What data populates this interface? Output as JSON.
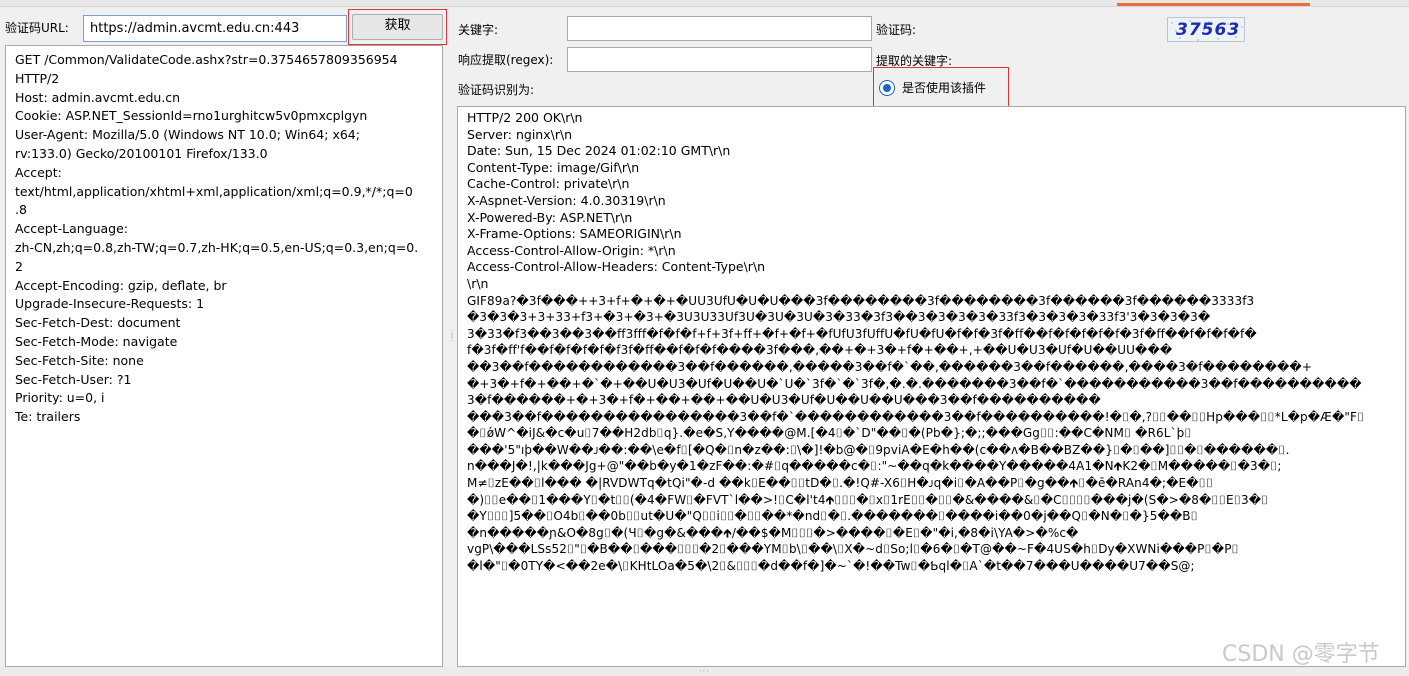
{
  "left": {
    "url_label": "验证码URL:",
    "url_value": "https://admin.avcmt.edu.cn:443",
    "fetch_button": "获取",
    "request_lines": [
      "GET /Common/ValidateCode.ashx?str=0.3754657809356954",
      "HTTP/2",
      "Host: admin.avcmt.edu.cn",
      "Cookie: ASP.NET_SessionId=rno1urghitcw5v0pmxcplgyn",
      "User-Agent: Mozilla/5.0 (Windows NT 10.0; Win64; x64;",
      "rv:133.0) Gecko/20100101 Firefox/133.0",
      "Accept:",
      "text/html,application/xhtml+xml,application/xml;q=0.9,*/*;q=0",
      ".8",
      "Accept-Language:",
      "zh-CN,zh;q=0.8,zh-TW;q=0.7,zh-HK;q=0.5,en-US;q=0.3,en;q=0.",
      "2",
      "Accept-Encoding: gzip, deflate, br",
      "Upgrade-Insecure-Requests: 1",
      "Sec-Fetch-Dest: document",
      "Sec-Fetch-Mode: navigate",
      "Sec-Fetch-Site: none",
      "Sec-Fetch-User: ?1",
      "Priority: u=0, i",
      "Te: trailers"
    ]
  },
  "right": {
    "keyword_label": "关键字:",
    "keyword_value": "",
    "regex_label": "响应提取(regex):",
    "regex_value": "",
    "recognized_label": "验证码识别为:",
    "captcha_label": "验证码:",
    "captcha_text": "37563",
    "extracted_label": "提取的关键字:",
    "plugin_radio_label": "是否使用该插件",
    "plugin_radio_checked": true,
    "response_lines": [
      "HTTP/2 200 OK\\r\\n",
      "Server: nginx\\r\\n",
      "Date: Sun, 15 Dec 2024 01:02:10 GMT\\r\\n",
      "Content-Type: image/Gif\\r\\n",
      "Cache-Control: private\\r\\n",
      "X-Aspnet-Version: 4.0.30319\\r\\n",
      "X-Powered-By: ASP.NET\\r\\n",
      "X-Frame-Options: SAMEORIGIN\\r\\n",
      "Access-Control-Allow-Origin: *\\r\\n",
      "Access-Control-Allow-Headers: Content-Type\\r\\n",
      "\\r\\n"
    ],
    "binary_lines": [
      "GIF89a?�3f���++3+f+�+�+�UU3UfU�U�U���3f��������3f��������3f������3f������3333f3",
      "�3�3�3+3+33+f3+�3+�3+�3U3U33Uf3U�3U�3U�3�33�3f3��3�3�3�3�33f3�3�3�3�33f3'3�3�3�3�",
      "3�33�f3��3��3��ff3fff�f�f�f+f+3f+ff+�f+�f+�fUfU3fUffU�fU�fU�f�f�3f�ff��f�f�f�f�f�3f�ff��f�f�f�f�",
      "f�3f�ff'f��f�f�f�f�f3f�ff��f�f�f����3f���,��+�+3�+f�+��+,+��U�U3�Uf�U��UU���",
      "��3��f������������3��f������,�����3��f�`��,������3��f������,����3�f��������+",
      "�+3�+f�+��+�`�+��U�U3�Uf�U��U�`U�`3f�`�`3f�,�.�.�������3��f�`�����������3��f����������",
      "3�f������+�+3�+f�+��+��+��U�U3�Uf�U��U��U���3��f����������",
      "���3��f����������������3��f�`������������3��f����������!�⌷�,?⌷⌷��⌷⌷Hp���⌷⌷*L�p�Æ�\"F⌷",
      "�⌷ǿW^�iJ&�c�u⌷7��H2db⌷q}.�e�S,Y����@M.[�4⌷�`D\"��⌷�(Pb�};�;;���Gg⌷⌷:��C�NM⌷       �R6L`þ⌷",
      "���'5\"ı⁠þ��W��ᴊ��:��\\e�f⌷[�Q�⌷n�z��:⌷\\�]!�b@�⌷9pviA�E�h��(c��ʌ�B��BZ��}⌷�⌷��]⌷⌷�⌷������⌷.",
      "n���J�!,|k���Jg+@\"��b�y�1�zF��:�#⌷q�����c�⌷:\"~��q�k����Y�����4A1�N🡹K2�⌷M�����⌷�3�⌷;",
      "M≠⌷zE��⌷l���         �|RVDWTq�tQi\"�-d       ��k⌷E��⌷⌷tD�⌷.�!Q#-X6⌷H�ᴊq�i⌷�A��P⌷�g��🡹⌷�ē�RAn4�;�E�⌷⌷",
      "�)⌷⌷e��⌷1���Y⌷�t⌷⌷(�4�FW⌷�FVT`l��>!⌷C�l't4🡹⌷⌷⌷�⌷x⌷1rE⌷⌷�⌷⌷�&����&⌷�C⌷⌷⌷⌷���j�(S�>�8�⌷⌷E⌷3�⌷",
      "�Y⌷⌷⌷]5��⌷O4b⌷��0b⌷⌷ut�U�\"Q⌷⌷i⌷⌷�⌷⌷��*�nd⌷�⌷.�������⌷����i��0�j��Q⌷�N�⌷�}5��B⌷",
      "�n�����ɲ&O�8g⌷�(Ч⌷�g�&���🡹/��$�M⌷⌷⌷�>����⌷�E⌷�\"�i,�8�i\\YA�>�%c�",
      "vgP\\���LSs52⌷\"⌷�B��⌷���⌷⌷⌷�2⌷���YM⌷b\\⌷��\\⌷X�~d⌷So;l⌷�6�⌷�T@��~F�4US�h⌷Dy�XWNi���P⌷�P⌷",
      "�l�\"⌷�0TY�<��2e�\\⌷KHtLOa�5�\\2⌷&⌷⌷⌷�d��f�]�~`�!��Tw⌷�Ƅql�⌷A`�t��7���U����U7��S@;"
    ]
  },
  "watermark": "CSDN @零字节"
}
